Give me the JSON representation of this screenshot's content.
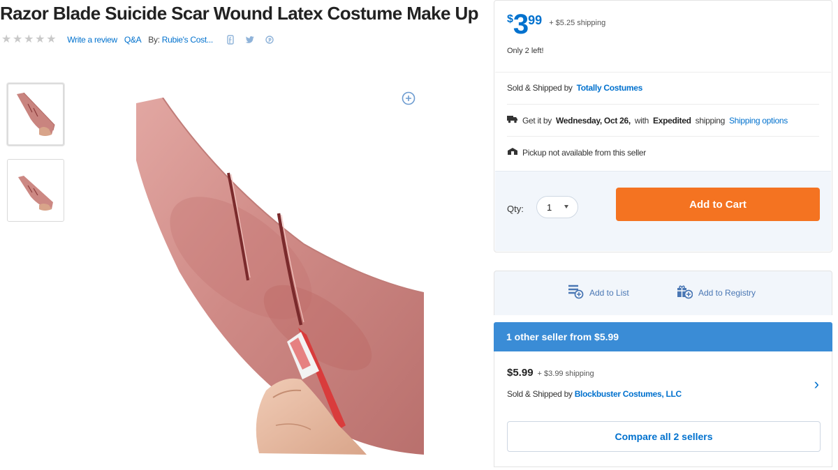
{
  "product": {
    "title": "Razor Blade Suicide Scar Wound Latex Costume Make Up",
    "rating_stars": 5,
    "write_review": "Write a review",
    "qa": "Q&A",
    "by_label": "By:",
    "brand": "Rubie's Cost..."
  },
  "share": {
    "icons": [
      "facebook-icon",
      "twitter-icon",
      "pinterest-icon"
    ]
  },
  "buybox": {
    "currency": "$",
    "price_dollars": "3",
    "price_cents": "99",
    "shipping": "+ $5.25 shipping",
    "stock": "Only 2 left!",
    "sold_by_label": "Sold & Shipped by",
    "seller": "Totally Costumes",
    "delivery_prefix": "Get it by",
    "delivery_date": "Wednesday, Oct 26,",
    "delivery_with": "with",
    "delivery_method": "Expedited",
    "delivery_suffix": "shipping",
    "shipping_options": "Shipping options",
    "pickup": "Pickup not available from this seller",
    "qty_label": "Qty:",
    "qty_value": "1",
    "add_to_cart": "Add to Cart"
  },
  "lists": {
    "add_to_list": "Add to List",
    "add_to_registry": "Add to Registry"
  },
  "other_sellers": {
    "header": "1 other seller from $5.99",
    "price": "$5.99",
    "shipping": "+ $3.99 shipping",
    "sold_by_label": "Sold & Shipped by",
    "seller": "Blockbuster Costumes, LLC",
    "compare": "Compare all 2 sellers"
  },
  "colors": {
    "accent": "#0071ce",
    "cta": "#f47321",
    "banner": "#3a8cd6"
  }
}
